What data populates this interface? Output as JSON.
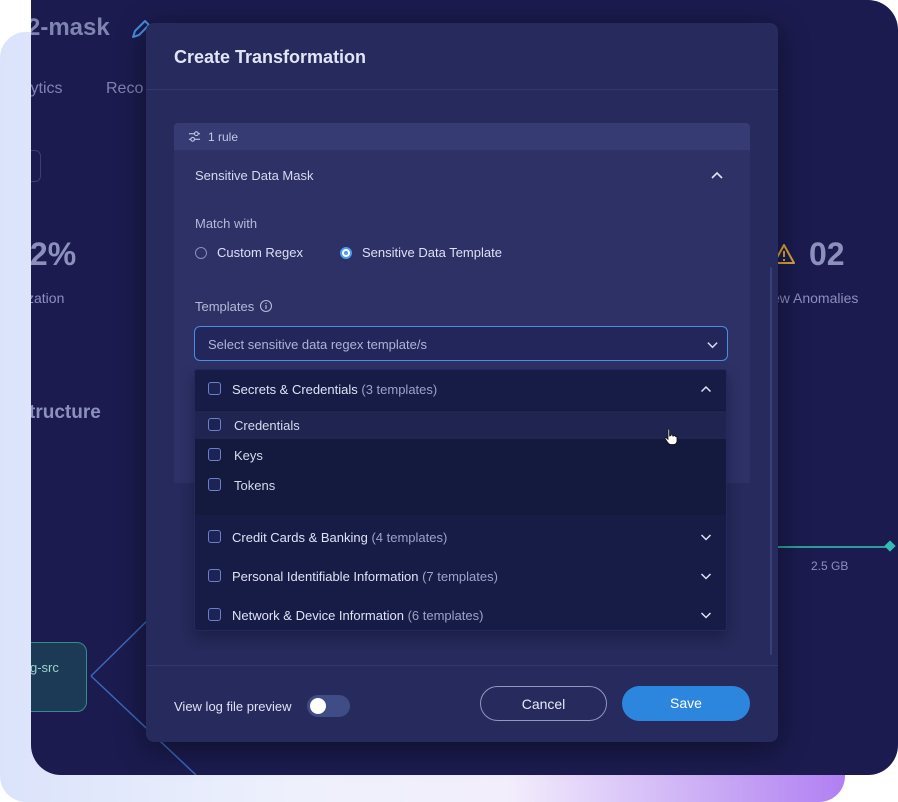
{
  "background": {
    "title": "2-mask",
    "tabs": [
      "lytics",
      "Reco"
    ],
    "stat_left_value": ".2%",
    "stat_left_label": "zation",
    "stat_right_value": "02",
    "stat_right_label": "ew Anomalies",
    "section_heading": "tructure",
    "node_label": "g-src",
    "edge_label": "2.5 GB"
  },
  "modal": {
    "title": "Create Transformation",
    "rule_count_label": "1 rule",
    "rule_name": "Sensitive Data Mask",
    "match_with_label": "Match with",
    "match_options": [
      {
        "label": "Custom Regex",
        "selected": false
      },
      {
        "label": "Sensitive Data Template",
        "selected": true
      }
    ],
    "templates_label": "Templates",
    "select_placeholder": "Select sensitive data regex template/s",
    "template_groups": [
      {
        "name": "Secrets & Credentials",
        "count": "(3 templates)",
        "expanded": true,
        "items": [
          "Credentials",
          "Keys",
          "Tokens"
        ]
      },
      {
        "name": "Credit Cards & Banking",
        "count": "(4 templates)",
        "expanded": false
      },
      {
        "name": "Personal Identifiable Information",
        "count": "(7 templates)",
        "expanded": false
      },
      {
        "name": "Network & Device Information",
        "count": "(6 templates)",
        "expanded": false
      }
    ],
    "footer": {
      "preview_label": "View log file preview",
      "preview_enabled": false,
      "cancel_label": "Cancel",
      "save_label": "Save"
    }
  },
  "colors": {
    "app_background": "#1b1b4f",
    "modal_background": "#262a5c",
    "accent_blue": "#2d86dd",
    "teal": "#2f9b98",
    "warning": "#d9a23a"
  },
  "icons": [
    "pencil-icon",
    "sliders-icon",
    "chevron-up-icon",
    "chevron-down-icon",
    "info-icon",
    "warning-icon",
    "pointer-cursor-icon"
  ]
}
